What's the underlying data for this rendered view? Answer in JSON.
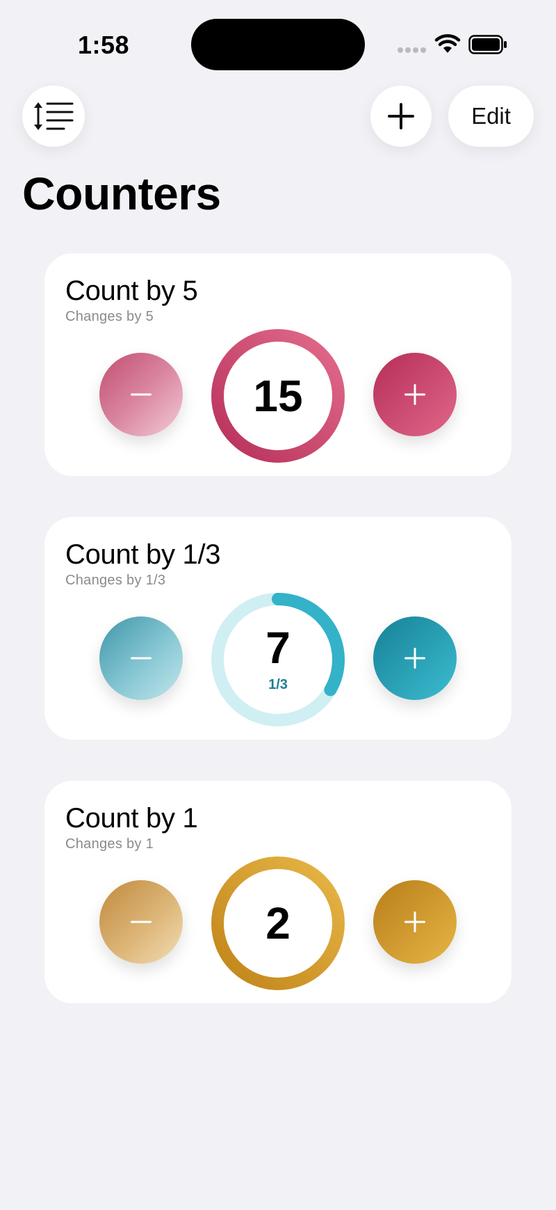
{
  "status_bar": {
    "time": "1:58"
  },
  "toolbar": {
    "edit_label": "Edit"
  },
  "page": {
    "title": "Counters"
  },
  "counters": [
    {
      "title": "Count by 5",
      "subtitle": "Changes by 5",
      "value": "15",
      "fraction": "",
      "progress": 1.0,
      "minus_label": "−",
      "plus_label": "+",
      "color": "#d0486e"
    },
    {
      "title": "Count by 1/3",
      "subtitle": "Changes by 1/3",
      "value": "7",
      "fraction": "1/3",
      "progress": 0.333,
      "minus_label": "−",
      "plus_label": "+",
      "color": "#2aa9bf"
    },
    {
      "title": "Count by 1",
      "subtitle": "Changes by 1",
      "value": "2",
      "fraction": "",
      "progress": 1.0,
      "minus_label": "−",
      "plus_label": "+",
      "color": "#d9a030"
    }
  ]
}
